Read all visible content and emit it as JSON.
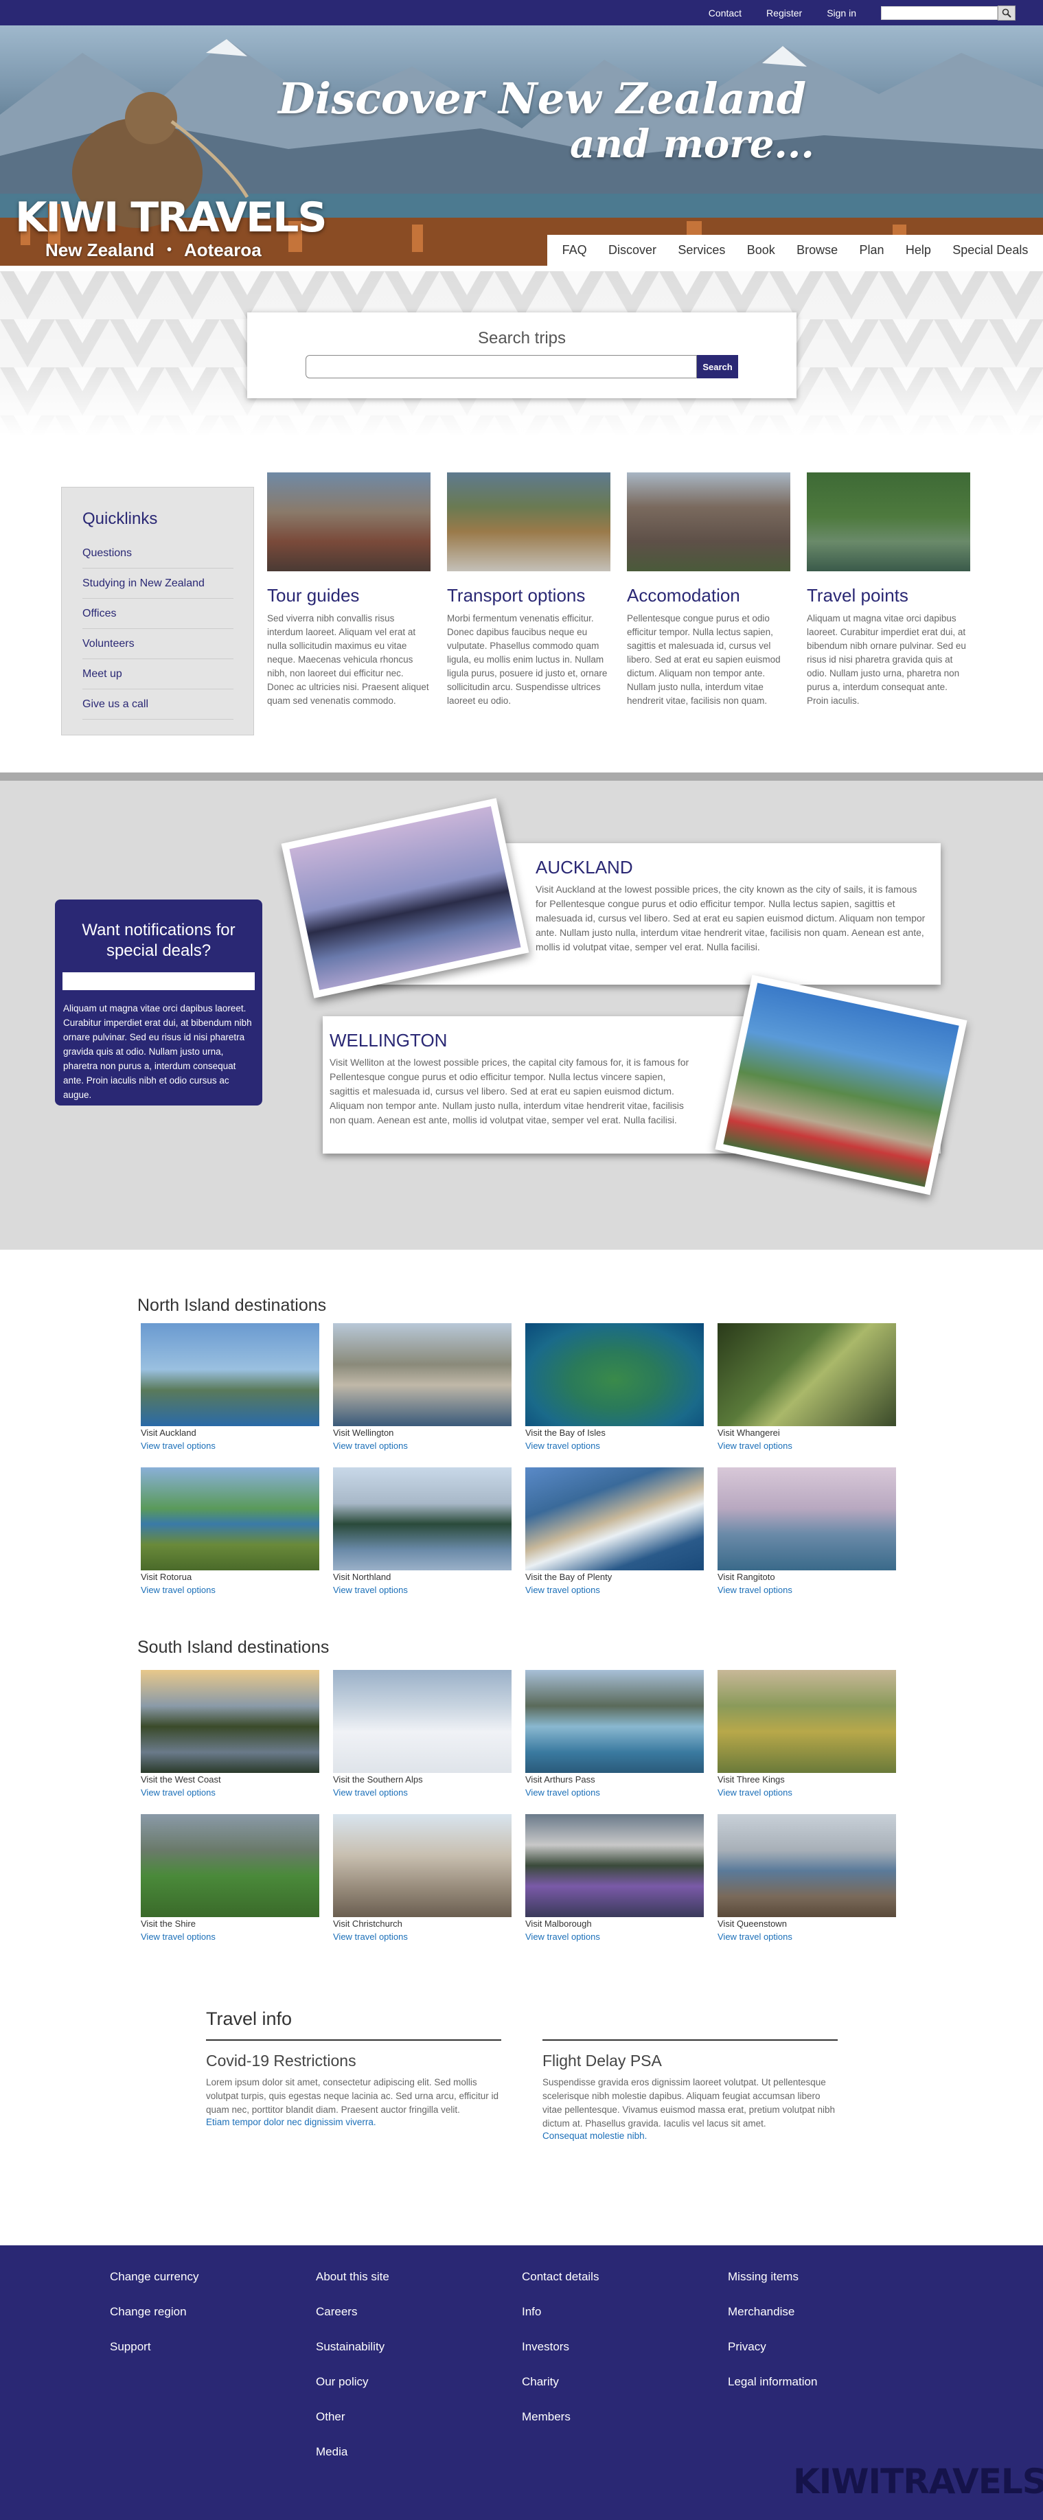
{
  "topbar": {
    "links": [
      "Contact",
      "Register",
      "Sign in"
    ],
    "search_placeholder": ""
  },
  "hero": {
    "tagline_line1": "Discover New Zealand",
    "tagline_line2": "and more...",
    "brand": "KIWI TRAVELS",
    "sub_left": "New Zealand",
    "sub_dot": "•",
    "sub_right": "Aotearoa"
  },
  "nav": {
    "items": [
      "FAQ",
      "Discover",
      "Services",
      "Book",
      "Browse",
      "Plan",
      "Help",
      "Special Deals"
    ]
  },
  "search": {
    "title": "Search trips",
    "button": "Search"
  },
  "quicklinks": {
    "title": "Quicklinks",
    "items": [
      "Questions",
      "Studying in New Zealand",
      "Offices",
      "Volunteers",
      "Meet up",
      "Give us a call"
    ]
  },
  "features": [
    {
      "title": "Tour guides",
      "text": "Sed viverra nibh convallis risus interdum laoreet. Aliquam vel erat at nulla sollicitudin maximus eu vitae neque. Maecenas vehicula rhoncus nibh, non laoreet dui efficitur nec. Donec ac ultricies nisi. Praesent aliquet quam sed venenatis commodo."
    },
    {
      "title": "Transport options",
      "text": "Morbi fermentum venenatis efficitur. Donec dapibus faucibus neque eu vulputate. Phasellus commodo quam ligula, eu mollis enim luctus in. Nullam ligula purus, posuere id justo et, ornare sollicitudin arcu. Suspendisse ultrices laoreet eu odio."
    },
    {
      "title": "Accomodation",
      "text": "Pellentesque congue purus et odio efficitur tempor. Nulla lectus sapien, sagittis et malesuada id, cursus vel libero. Sed at erat eu sapien euismod dictum. Aliquam non tempor ante. Nullam justo nulla, interdum vitae hendrerit vitae, facilisis non quam."
    },
    {
      "title": "Travel points",
      "text": "Aliquam ut magna vitae orci dapibus laoreet. Curabitur imperdiet erat dui, at bibendum nibh ornare pulvinar. Sed eu risus id nisi pharetra gravida quis at odio. Nullam justo urna, pharetra non purus a, interdum consequat ante. Proin iaculis."
    }
  ],
  "notify": {
    "title": "Want notifications for special deals?",
    "text": "Aliquam ut magna vitae orci dapibus laoreet. Curabitur imperdiet erat dui, at bibendum nibh ornare pulvinar. Sed eu risus id nisi pharetra gravida quis at odio. Nullam justo urna, pharetra non purus a, interdum consequat ante. Proin iaculis nibh et odio cursus ac augue."
  },
  "cities": {
    "auckland": {
      "title": "AUCKLAND",
      "text": "Visit Auckland at the lowest possible prices, the city known as the city of sails, it is famous for Pellentesque congue purus et odio efficitur tempor. Nulla lectus sapien, sagittis et malesuada id, cursus vel libero. Sed at erat eu sapien euismod dictum. Aliquam non tempor ante. Nullam justo nulla, interdum vitae hendrerit vitae, facilisis non quam. Aenean est ante, mollis id volutpat vitae, semper vel erat. Nulla facilisi."
    },
    "wellington": {
      "title": "WELLINGTON",
      "text": "Visit Welliton at the lowest possible prices, the capital city famous for, it is famous for Pellentesque congue purus et odio efficitur tempor. Nulla lectus vincere sapien, sagittis et malesuada id, cursus vel libero. Sed at erat eu sapien euismod dictum. Aliquam non tempor ante. Nullam justo nulla, interdum vitae hendrerit vitae, facilisis non quam. Aenean est ante, mollis id volutpat vitae, semper vel erat. Nulla facilisi."
    }
  },
  "north": {
    "title": "North Island destinations",
    "link": "View travel options",
    "items": [
      "Visit Auckland",
      "Visit Wellington",
      "Visit the Bay of Isles",
      "Visit Whangerei",
      "Visit Rotorua",
      "Visit Northland",
      "Visit the Bay of Plenty",
      "Visit Rangitoto"
    ]
  },
  "south": {
    "title": "South Island destinations",
    "link": "View travel options",
    "items": [
      "Visit the West Coast",
      "Visit the Southern Alps",
      "Visit Arthurs Pass",
      "Visit Three Kings",
      "Visit the Shire",
      "Visit Christchurch",
      "Visit Malborough",
      "Visit Queenstown"
    ]
  },
  "travel_info": {
    "title": "Travel info",
    "covid": {
      "title": "Covid-19 Restrictions",
      "text": "Lorem ipsum dolor sit amet, consectetur adipiscing elit. Sed mollis volutpat turpis, quis egestas neque lacinia ac. Sed urna arcu, efficitur id quam nec, porttitor blandit diam. Praesent auctor fringilla velit.",
      "more": "Etiam tempor dolor nec dignissim viverra."
    },
    "flight": {
      "title": "Flight Delay PSA",
      "text": "Suspendisse gravida eros dignissim laoreet volutpat. Ut pellentesque scelerisque nibh molestie dapibus. Aliquam feugiat accumsan libero vitae pellentesque. Vivamus euismod massa erat, pretium volutpat nibh dictum at. Phasellus gravida. Iaculis vel lacus sit amet.",
      "more": "Consequat molestie nibh."
    }
  },
  "footer": {
    "col1": [
      "Change currency",
      "Change region",
      "Support"
    ],
    "col2": [
      "About this site",
      "Careers",
      "Sustainability",
      "Our policy",
      "Other",
      "Media"
    ],
    "col3": [
      "Contact details",
      "Info",
      "Investors",
      "Charity",
      "Members"
    ],
    "col4": [
      "Missing items",
      "Merchandise",
      "Privacy",
      "Legal information"
    ],
    "logo": "KIWITRAVELS"
  }
}
